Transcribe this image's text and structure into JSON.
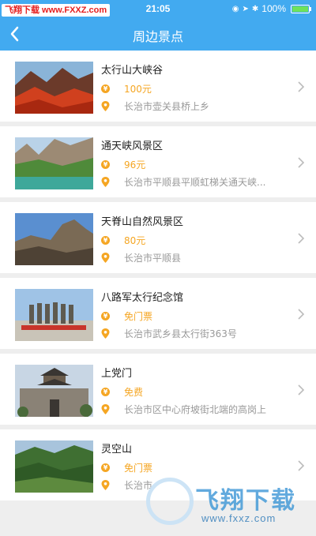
{
  "statusbar": {
    "watermark": "飞翔下载 www.FXXZ.com",
    "time": "21:05",
    "battery": "100%"
  },
  "navbar": {
    "title": "周边景点"
  },
  "spots": [
    {
      "name": "太行山大峡谷",
      "price": "100元",
      "address": "长治市壶关县桥上乡"
    },
    {
      "name": "通天峡风景区",
      "price": "96元",
      "address": "长治市平顺县平顺虹梯关通天峡..."
    },
    {
      "name": "天脊山自然风景区",
      "price": "80元",
      "address": "长治市平顺县"
    },
    {
      "name": "八路军太行纪念馆",
      "price": "免门票",
      "address": "长治市武乡县太行街363号"
    },
    {
      "name": "上党门",
      "price": "免费",
      "address": "长治市区中心府坡街北端的高岗上"
    },
    {
      "name": "灵空山",
      "price": "免门票",
      "address": "长治市"
    }
  ],
  "bottom_watermark": {
    "text": "飞翔下载",
    "url": "www.fxxz.com"
  },
  "colors": {
    "header": "#42aaf0",
    "price": "#f5a623",
    "address": "#999999"
  },
  "icons": {
    "back": "chevron-left-icon",
    "price": "coin-icon",
    "location": "location-pin-icon",
    "detail": "chevron-right-icon"
  }
}
